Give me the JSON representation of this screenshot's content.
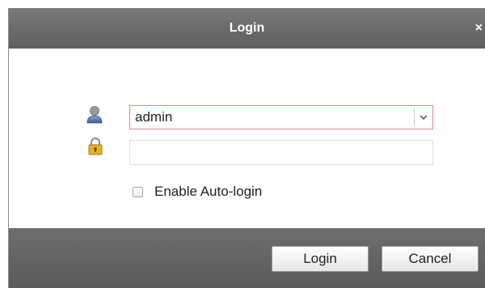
{
  "dialog": {
    "title": "Login",
    "close_glyph": "×"
  },
  "form": {
    "user_icon": "user-icon",
    "lock_icon": "lock-icon",
    "username_value": "admin",
    "password_value": "",
    "auto_login_label": "Enable Auto-login",
    "auto_login_checked": false
  },
  "buttons": {
    "login_label": "Login",
    "cancel_label": "Cancel"
  },
  "colors": {
    "titlebar": "#6b6b6b",
    "input_focus_border": "#e0848a",
    "user_icon": "#4a6fa5",
    "lock_icon": "#d9a520"
  }
}
